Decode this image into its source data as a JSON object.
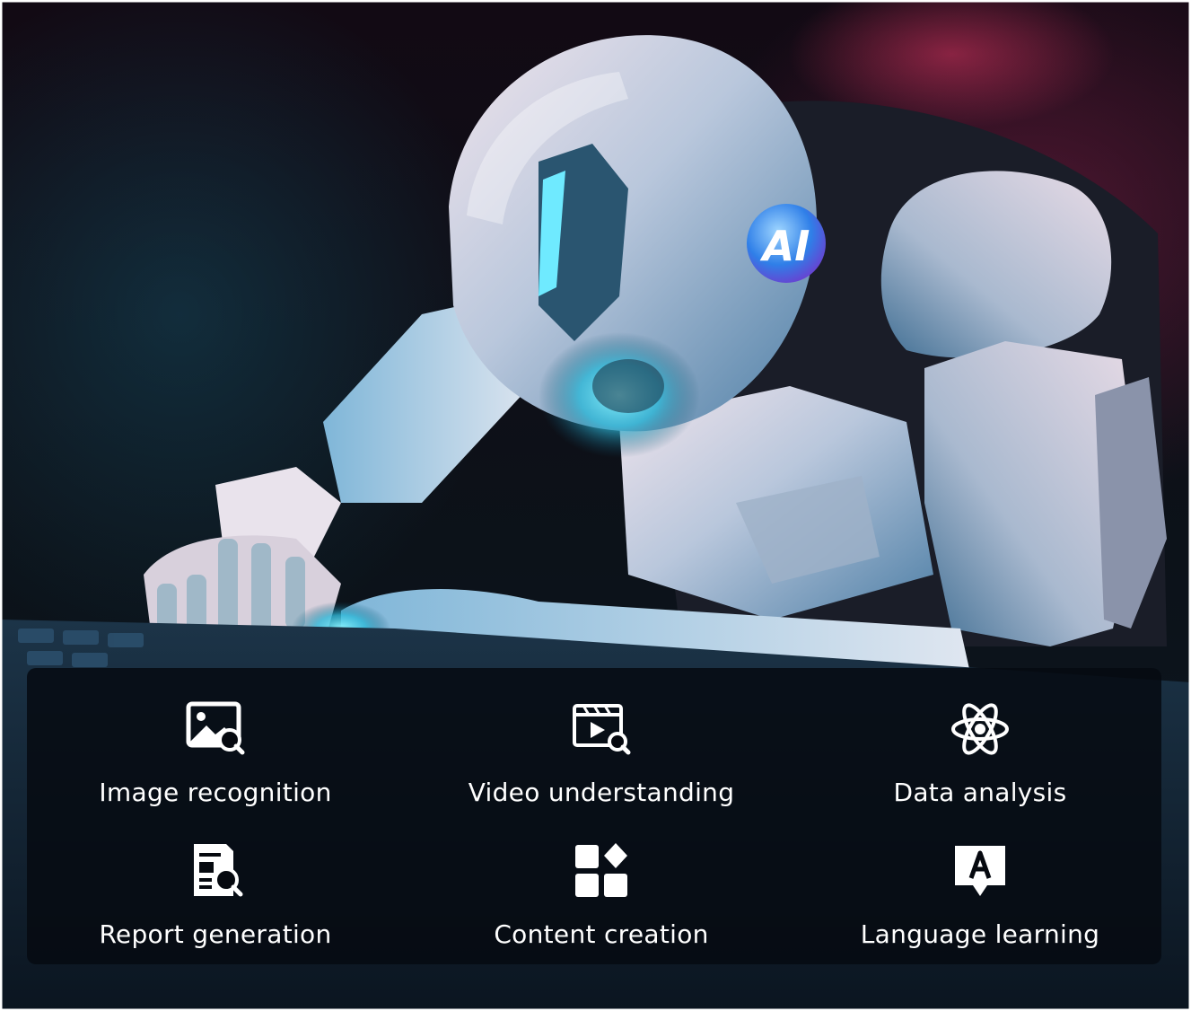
{
  "features": [
    {
      "label": "Image recognition",
      "icon": "image-search-icon"
    },
    {
      "label": "Video understanding",
      "icon": "video-search-icon"
    },
    {
      "label": "Data analysis",
      "icon": "atom-icon"
    },
    {
      "label": "Report generation",
      "icon": "report-search-icon"
    },
    {
      "label": "Content creation",
      "icon": "content-blocks-icon"
    },
    {
      "label": "Language learning",
      "icon": "language-bubble-icon"
    }
  ],
  "robot_badge": "AI",
  "colors": {
    "panel_bg": "#060a12",
    "text": "#ffffff",
    "robot_body": "#c9d2e0",
    "robot_glow": "#4fd8ff",
    "badge": "#3aa0ff"
  }
}
